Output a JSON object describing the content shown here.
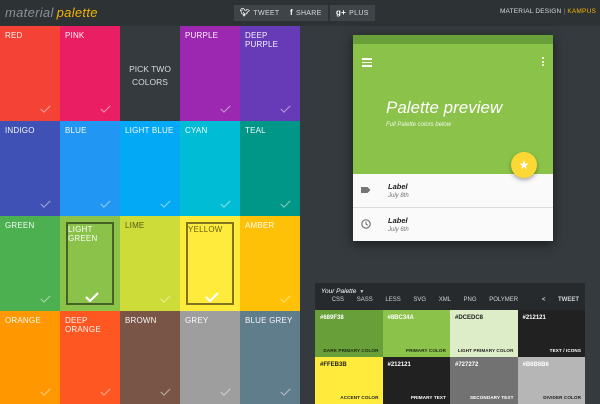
{
  "header": {
    "brand_part1": "material",
    "brand_part2": "palette",
    "tweet": "TWEET",
    "share": "SHARE",
    "plus": "PLUS",
    "top_link_1": "MATERIAL DESIGN",
    "top_link_sep": "|",
    "top_link_2": "KAMPUS"
  },
  "pick_two": "PICK TWO COLORS",
  "colors": [
    {
      "name": "RED",
      "hex": "#f44336"
    },
    {
      "name": "PINK",
      "hex": "#e91e63"
    },
    {
      "name": "",
      "hex": "#343a3d"
    },
    {
      "name": "PURPLE",
      "hex": "#9c27b0"
    },
    {
      "name": "DEEP PURPLE",
      "hex": "#673ab7"
    },
    {
      "name": "INDIGO",
      "hex": "#3f51b5"
    },
    {
      "name": "BLUE",
      "hex": "#2196f3"
    },
    {
      "name": "LIGHT BLUE",
      "hex": "#03a9f4"
    },
    {
      "name": "CYAN",
      "hex": "#00bcd4"
    },
    {
      "name": "TEAL",
      "hex": "#009688"
    },
    {
      "name": "GREEN",
      "hex": "#4caf50"
    },
    {
      "name": "LIGHT GREEN",
      "hex": "#8bc34a"
    },
    {
      "name": "LIME",
      "hex": "#cddc39"
    },
    {
      "name": "YELLOW",
      "hex": "#ffeb3b"
    },
    {
      "name": "AMBER",
      "hex": "#ffc107"
    },
    {
      "name": "ORANGE",
      "hex": "#ff9800"
    },
    {
      "name": "DEEP ORANGE",
      "hex": "#ff5722"
    },
    {
      "name": "BROWN",
      "hex": "#795548"
    },
    {
      "name": "GREY",
      "hex": "#9e9e9e"
    },
    {
      "name": "BLUE GREY",
      "hex": "#607d8b"
    }
  ],
  "preview": {
    "title": "Palette preview",
    "subtitle": "Full Palette colors below",
    "items": [
      {
        "label": "Label",
        "date": "July 8th",
        "icon": "label-icon"
      },
      {
        "label": "Label",
        "date": "July 6th",
        "icon": "clock-icon"
      }
    ],
    "primary_dark": "#689f38",
    "primary": "#8bc34a",
    "accent": "#fdd835"
  },
  "palette": {
    "heading": "Your Palette",
    "exports": [
      "CSS",
      "SASS",
      "LESS",
      "SVG",
      "XML",
      "PNG",
      "POLYMER"
    ],
    "tweet": "TWEET",
    "swatches": [
      {
        "hex": "#689F38",
        "role": "DARK PRIMARY COLOR",
        "bg": "#689f38",
        "fg": "#ffffff",
        "role_fg": "#1b2a10"
      },
      {
        "hex": "#8BC34A",
        "role": "PRIMARY COLOR",
        "bg": "#8bc34a",
        "fg": "#ffffff",
        "role_fg": "#1b2a10"
      },
      {
        "hex": "#DCEDC8",
        "role": "LIGHT PRIMARY COLOR",
        "bg": "#dcedc8",
        "fg": "#212121",
        "role_fg": "#212121"
      },
      {
        "hex": "#212121",
        "role": "TEXT / ICONS",
        "bg": "#212121",
        "fg": "#ffffff",
        "role_fg": "#ffffff"
      },
      {
        "hex": "#FFEB3B",
        "role": "ACCENT COLOR",
        "bg": "#ffeb3b",
        "fg": "#212121",
        "role_fg": "#212121"
      },
      {
        "hex": "#212121",
        "role": "PRIMARY TEXT",
        "bg": "#212121",
        "fg": "#ffffff",
        "role_fg": "#ffffff"
      },
      {
        "hex": "#727272",
        "role": "SECONDARY TEXT",
        "bg": "#727272",
        "fg": "#ffffff",
        "role_fg": "#ffffff"
      },
      {
        "hex": "#B6B6B6",
        "role": "DIVIDER COLOR",
        "bg": "#b6b6b6",
        "fg": "#ffffff",
        "role_fg": "#212121"
      }
    ]
  }
}
